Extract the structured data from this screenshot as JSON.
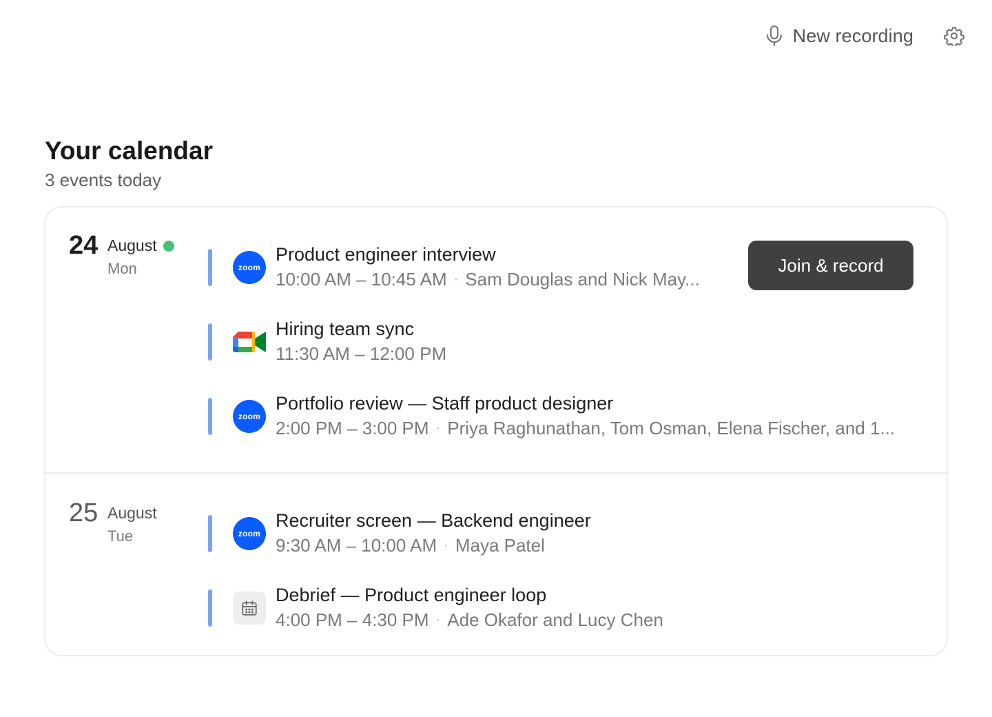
{
  "toolbar": {
    "new_recording_label": "New recording"
  },
  "header": {
    "title": "Your calendar",
    "subtitle": "3 events today"
  },
  "join_button_label": "Join & record",
  "days": [
    {
      "day_number": "24",
      "month": "August",
      "weekday": "Mon",
      "is_today": true,
      "events": [
        {
          "title": "Product engineer interview",
          "time": "10:00 AM – 10:45 AM",
          "attendees": "Sam Douglas and Nick May...",
          "platform": "zoom",
          "icon_label": "zoom"
        },
        {
          "title": "Hiring team sync",
          "time": "11:30 AM – 12:00 PM",
          "attendees": "",
          "platform": "google-meet"
        },
        {
          "title": "Portfolio review — Staff product designer",
          "time": "2:00 PM – 3:00 PM",
          "attendees": "Priya Raghunathan, Tom Osman, Elena Fischer, and 1...",
          "platform": "zoom",
          "icon_label": "zoom"
        }
      ]
    },
    {
      "day_number": "25",
      "month": "August",
      "weekday": "Tue",
      "is_today": false,
      "events": [
        {
          "title": "Recruiter screen — Backend engineer",
          "time": "9:30 AM – 10:00 AM",
          "attendees": "Maya Patel",
          "platform": "zoom",
          "icon_label": "zoom"
        },
        {
          "title": "Debrief — Product engineer loop",
          "time": "4:00 PM – 4:30 PM",
          "attendees": "Ade Okafor and Lucy Chen",
          "platform": "calendar"
        }
      ]
    }
  ],
  "colors": {
    "accent_bar": "#7aa3f5",
    "zoom_blue": "#0b5cff",
    "today_dot": "#46c07a",
    "button_bg": "#404040"
  }
}
